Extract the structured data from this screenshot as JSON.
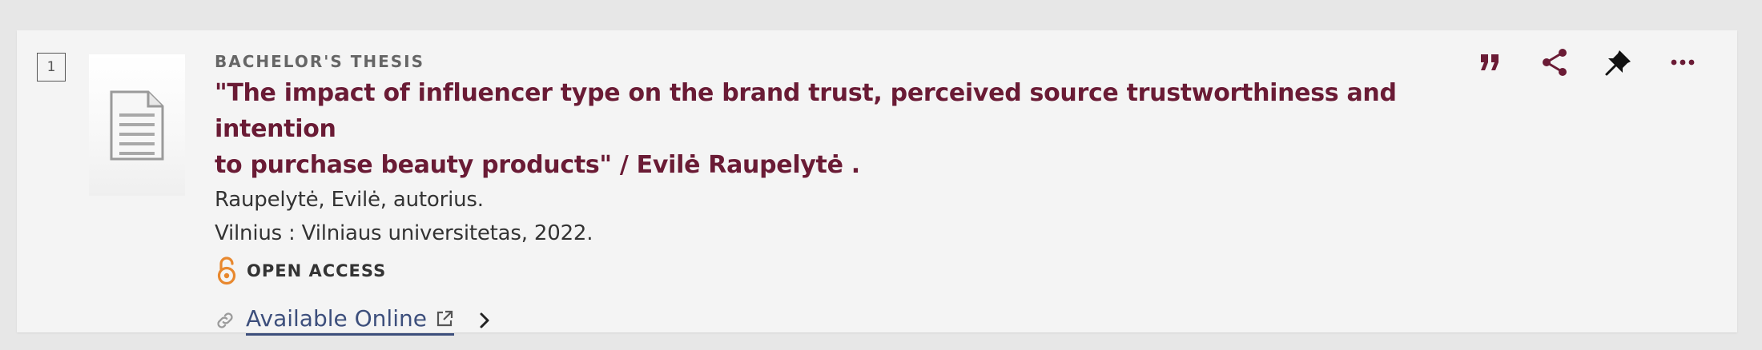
{
  "result": {
    "index": "1",
    "type": "BACHELOR'S THESIS",
    "title_line1": "\"The impact of influencer type on the brand trust, perceived source trustworthiness and intention",
    "title_line2": "to purchase beauty products\" / Evilė Raupelytė .",
    "author": "Raupelytė, Evilė, autorius.",
    "publisher": "Vilnius : Vilniaus universitetas, 2022.",
    "open_access_label": "OPEN ACCESS",
    "online_label": "Available Online"
  },
  "actions": [
    {
      "name": "cite-button",
      "icon": "quote-icon"
    },
    {
      "name": "share-button",
      "icon": "share-icon"
    },
    {
      "name": "pin-button",
      "icon": "pin-icon"
    },
    {
      "name": "more-button",
      "icon": "more-icon"
    }
  ],
  "colors": {
    "title": "#6a1b35",
    "link": "#3d4f7c",
    "open_access": "#e8882e",
    "action_icon": "#6a1b35"
  }
}
